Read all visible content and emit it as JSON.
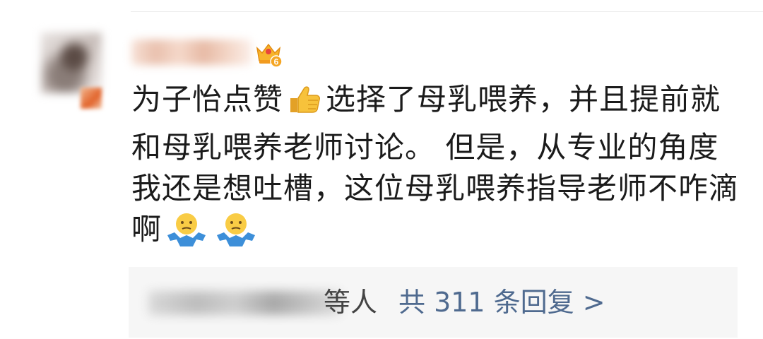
{
  "comment": {
    "segments": [
      {
        "type": "text",
        "value": "为子怡点赞"
      },
      {
        "type": "emoji",
        "icon": "thumbs-up-icon"
      },
      {
        "type": "text",
        "value": "选择了母乳喂养，并且提前就和母乳喂养老师讨论。 但是，从专业的角度我还是想吐槽，这位母乳喂养指导老师不咋滴啊"
      },
      {
        "type": "emoji",
        "icon": "shrug-emoji-icon"
      },
      {
        "type": "emoji",
        "icon": "shrug-emoji-icon"
      }
    ],
    "text_1": "为子怡点赞",
    "text_2": "选择了母乳喂养，并且提前就和母乳喂养老师讨论。 但是，从专业的角度我还是想吐槽，这位母乳喂养指导老师不咋滴啊"
  },
  "user": {
    "level": "6",
    "badge_icon": "crown-level-badge-icon"
  },
  "replies": {
    "suffix": "等人",
    "total_label": "共 311 条回复",
    "chevron": ">"
  },
  "colors": {
    "link": "#4f6a8f",
    "reply_bg": "#f6f6f6",
    "text": "#1b1b1b"
  }
}
